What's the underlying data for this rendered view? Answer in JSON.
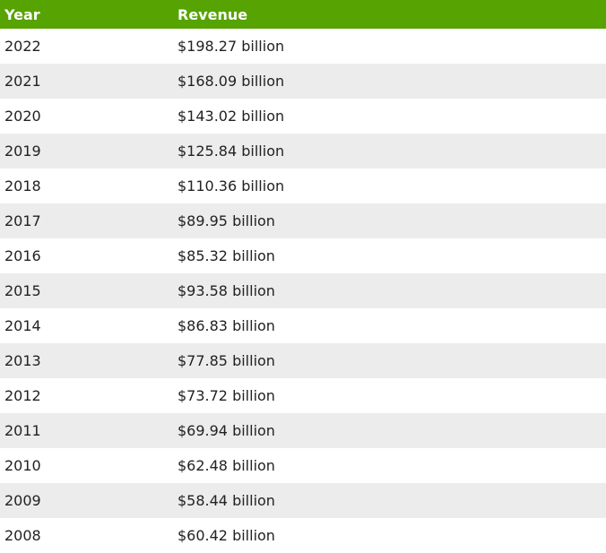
{
  "colors": {
    "header_bg": "#56a302",
    "header_text": "#ffffff",
    "stripe_bg": "#ececec"
  },
  "table": {
    "columns": [
      "Year",
      "Revenue"
    ],
    "rows": [
      [
        "2022",
        "$198.27 billion"
      ],
      [
        "2021",
        "$168.09 billion"
      ],
      [
        "2020",
        "$143.02 billion"
      ],
      [
        "2019",
        "$125.84 billion"
      ],
      [
        "2018",
        "$110.36 billion"
      ],
      [
        "2017",
        "$89.95 billion"
      ],
      [
        "2016",
        "$85.32 billion"
      ],
      [
        "2015",
        "$93.58 billion"
      ],
      [
        "2014",
        "$86.83 billion"
      ],
      [
        "2013",
        "$77.85 billion"
      ],
      [
        "2012",
        "$73.72 billion"
      ],
      [
        "2011",
        "$69.94 billion"
      ],
      [
        "2010",
        "$62.48 billion"
      ],
      [
        "2009",
        "$58.44 billion"
      ],
      [
        "2008",
        "$60.42 billion"
      ]
    ]
  }
}
